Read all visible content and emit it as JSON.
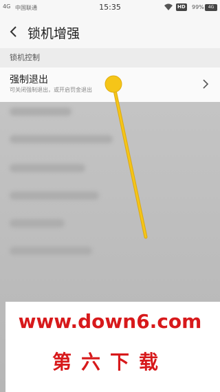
{
  "status_bar": {
    "signal": "4G",
    "carrier": "中国联通",
    "time": "15:35",
    "hd": "HD",
    "battery_percent": "99%",
    "battery_icon_text": "4G"
  },
  "header": {
    "title": "锁机增强"
  },
  "section": {
    "label": "锁机控制"
  },
  "setting": {
    "title": "强制退出",
    "subtitle": "可关闭强制退出，或开启罚金退出"
  },
  "watermark": {
    "url": "www.down6.com",
    "name": "第六下载"
  },
  "colors": {
    "accent_touch": "#f5c518",
    "watermark_red": "#d7191b"
  }
}
